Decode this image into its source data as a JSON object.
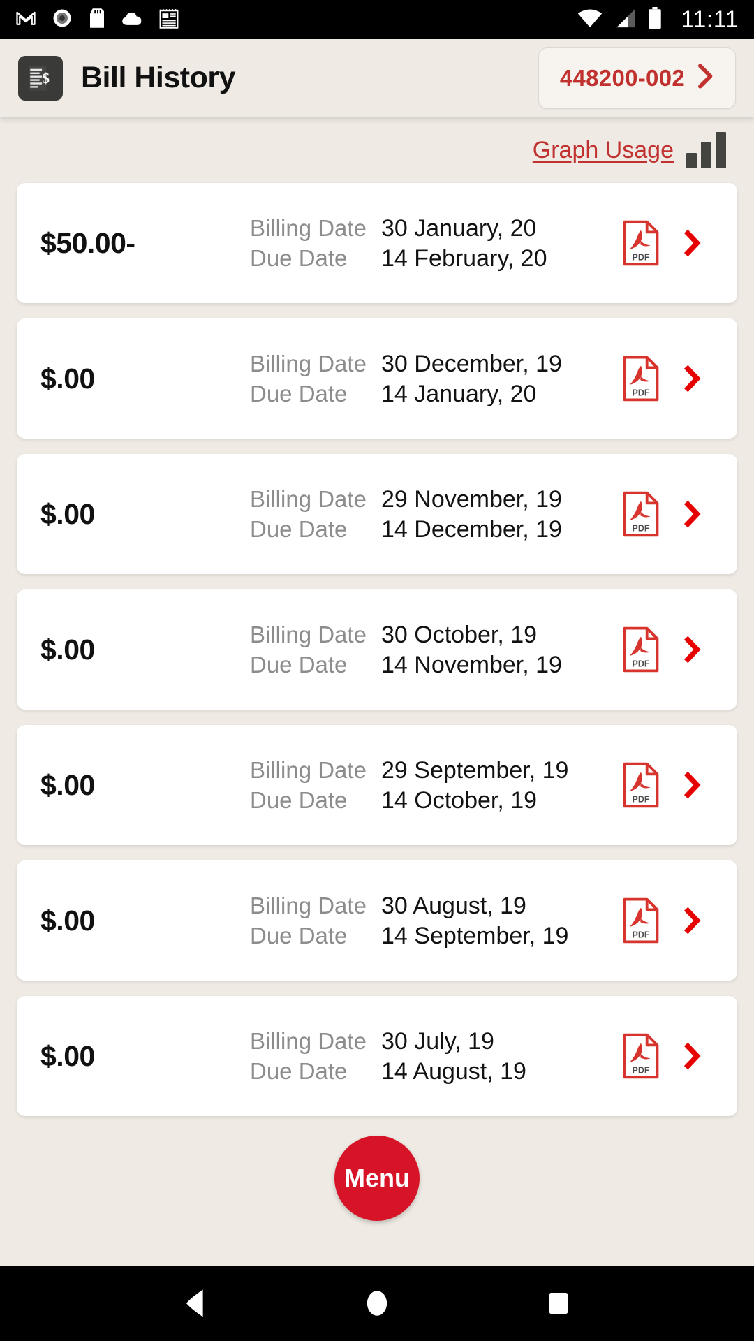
{
  "status_bar": {
    "time": "11:11",
    "left_icons": [
      "gmail-icon",
      "record-icon",
      "sd-card-icon",
      "cloud-icon",
      "news-icon"
    ],
    "right_icons": [
      "wifi-icon",
      "cell-signal-icon",
      "battery-icon"
    ]
  },
  "app_bar": {
    "title": "Bill History",
    "icon": "bill-document-icon",
    "account_number": "448200-002",
    "account_chevron": "chevron-right-icon"
  },
  "usage": {
    "link_label": "Graph Usage",
    "icon": "bar-chart-icon"
  },
  "colors": {
    "accent_red": "#C1312F",
    "chevron_red": "#E60000",
    "fab_red": "#D71327",
    "page_background": "#EFEAE4",
    "card_background": "#FFFFFF",
    "label_gray": "#8C8C8C"
  },
  "labels": {
    "billing_date": "Billing Date",
    "due_date": "Due Date",
    "pdf_badge": "PDF"
  },
  "bills": [
    {
      "amount": "$50.00-",
      "billing_date": "30 January, 20",
      "due_date": "14 February, 20"
    },
    {
      "amount": "$.00",
      "billing_date": "30 December, 19",
      "due_date": "14 January, 20"
    },
    {
      "amount": "$.00",
      "billing_date": "29 November, 19",
      "due_date": "14 December, 19"
    },
    {
      "amount": "$.00",
      "billing_date": "30 October, 19",
      "due_date": "14 November, 19"
    },
    {
      "amount": "$.00",
      "billing_date": "29 September, 19",
      "due_date": "14 October, 19"
    },
    {
      "amount": "$.00",
      "billing_date": "30 August, 19",
      "due_date": "14 September, 19"
    },
    {
      "amount": "$.00",
      "billing_date": "30 July, 19",
      "due_date": "14 August, 19"
    }
  ],
  "fab": {
    "label": "Menu"
  },
  "nav_bar": {
    "back": "back-triangle-icon",
    "home": "home-circle-icon",
    "recents": "recents-square-icon"
  }
}
